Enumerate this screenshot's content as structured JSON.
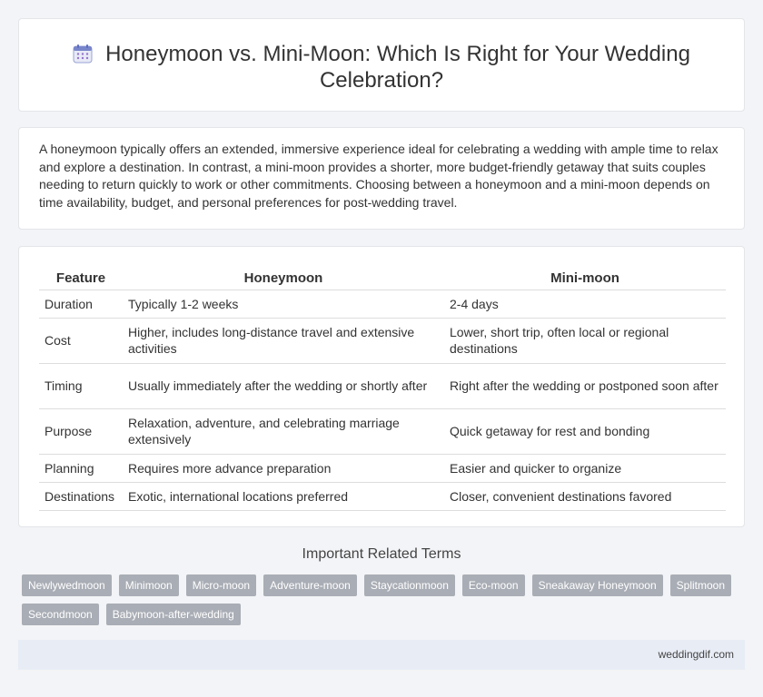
{
  "header": {
    "title_line1": "Honeymoon vs. Mini-Moon: Which Is Right for Your Wedding",
    "title_line2": "Celebration?",
    "icon": "calendar-icon"
  },
  "intro": {
    "text": "A honeymoon typically offers an extended, immersive experience ideal for celebrating a wedding with ample time to relax and explore a destination. In contrast, a mini-moon provides a shorter, more budget-friendly getaway that suits couples needing to return quickly to work or other commitments. Choosing between a honeymoon and a mini-moon depends on time availability, budget, and personal preferences for post-wedding travel."
  },
  "table": {
    "headers": [
      "Feature",
      "Honeymoon",
      "Mini-moon"
    ],
    "rows": [
      [
        "Duration",
        "Typically 1-2 weeks",
        "2-4 days"
      ],
      [
        "Cost",
        "Higher, includes long-distance travel and extensive activities",
        "Lower, short trip, often local or regional destinations"
      ],
      [
        "Timing",
        "Usually immediately after the wedding or shortly after",
        "Right after the wedding or postponed soon after"
      ],
      [
        "Purpose",
        "Relaxation, adventure, and celebrating marriage extensively",
        "Quick getaway for rest and bonding"
      ],
      [
        "Planning",
        "Requires more advance preparation",
        "Easier and quicker to organize"
      ],
      [
        "Destinations",
        "Exotic, international locations preferred",
        "Closer, convenient destinations favored"
      ]
    ]
  },
  "related": {
    "title": "Important Related Terms",
    "tags": [
      "Newlywedmoon",
      "Minimoon",
      "Micro-moon",
      "Adventure-moon",
      "Staycationmoon",
      "Eco-moon",
      "Sneakaway Honeymoon",
      "Splitmoon",
      "Secondmoon",
      "Babymoon-after-wedding"
    ]
  },
  "footer": {
    "site": "weddingdif.com"
  }
}
